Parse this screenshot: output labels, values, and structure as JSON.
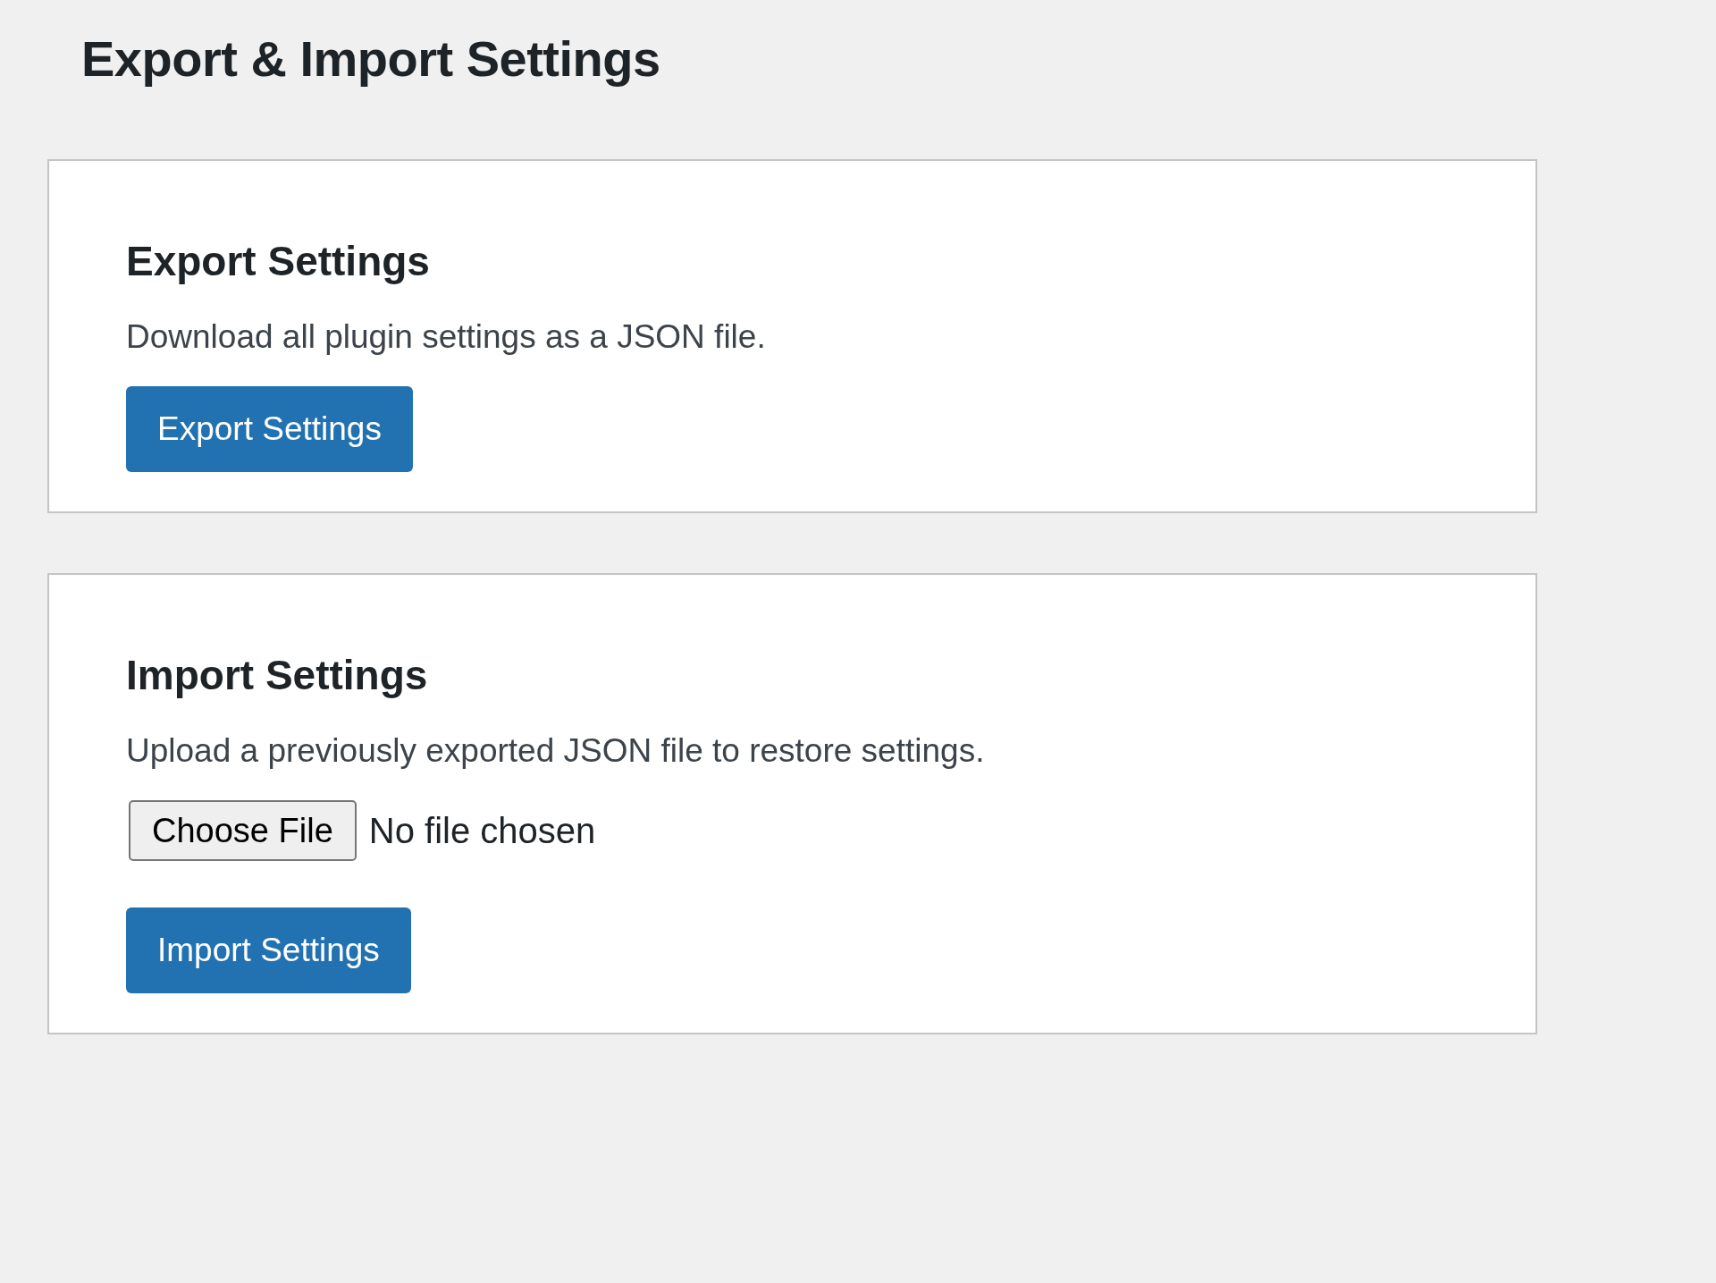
{
  "page_title": "Export & Import Settings",
  "sections": [
    {
      "kind": "export",
      "heading": "Export Settings",
      "description": "Download all plugin settings as a JSON file.",
      "button": "Export Settings"
    },
    {
      "kind": "import",
      "heading": "Import Settings",
      "description": "Upload a previously exported JSON file to restore settings.",
      "file_button": "Choose File",
      "file_status": "No file chosen",
      "button": "Import Settings"
    }
  ]
}
